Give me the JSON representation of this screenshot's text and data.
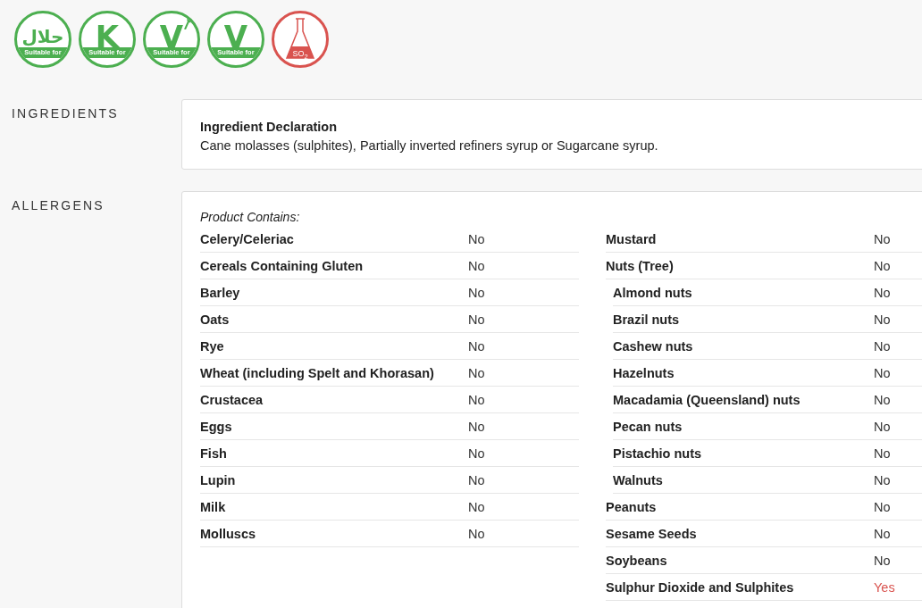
{
  "badges": [
    {
      "kind": "suitable",
      "symbol": "حلال",
      "caption": "Suitable for"
    },
    {
      "kind": "suitable",
      "symbol": "K",
      "caption": "Suitable for"
    },
    {
      "kind": "suitable_leaf",
      "symbol": "V",
      "caption": "Suitable for"
    },
    {
      "kind": "suitable",
      "symbol": "V",
      "caption": "Suitable for"
    },
    {
      "kind": "contains",
      "symbol": "SO$_{2}$"
    }
  ],
  "ingredients": {
    "heading": "INGREDIENTS",
    "title": "Ingredient Declaration",
    "text": "Cane molasses (sulphites), Partially inverted refiners syrup or Sugarcane syrup."
  },
  "allergens": {
    "heading": "ALLERGENS",
    "subtitle": "Product Contains:",
    "columns": [
      [
        {
          "name": "Celery/Celeriac",
          "value": "No",
          "contains": false
        },
        {
          "name": "Cereals Containing Gluten",
          "value": "No",
          "contains": false
        },
        {
          "name": "Barley",
          "value": "No",
          "contains": false
        },
        {
          "name": "Oats",
          "value": "No",
          "contains": false
        },
        {
          "name": "Rye",
          "value": "No",
          "contains": false
        },
        {
          "name": "Wheat (including Spelt and Khorasan)",
          "value": "No",
          "contains": false
        },
        {
          "name": "Crustacea",
          "value": "No",
          "contains": false
        },
        {
          "name": "Eggs",
          "value": "No",
          "contains": false
        },
        {
          "name": "Fish",
          "value": "No",
          "contains": false
        },
        {
          "name": "Lupin",
          "value": "No",
          "contains": false
        },
        {
          "name": "Milk",
          "value": "No",
          "contains": false
        },
        {
          "name": "Molluscs",
          "value": "No",
          "contains": false
        }
      ],
      [
        {
          "name": "Mustard",
          "value": "No",
          "contains": false
        },
        {
          "name": "Nuts (Tree)",
          "value": "No",
          "contains": false,
          "children": [
            {
              "name": "Almond nuts",
              "value": "No",
              "contains": false
            },
            {
              "name": "Brazil nuts",
              "value": "No",
              "contains": false
            },
            {
              "name": "Cashew nuts",
              "value": "No",
              "contains": false
            },
            {
              "name": "Hazelnuts",
              "value": "No",
              "contains": false
            },
            {
              "name": "Macadamia (Queensland) nuts",
              "value": "No",
              "contains": false
            },
            {
              "name": "Pecan nuts",
              "value": "No",
              "contains": false
            },
            {
              "name": "Pistachio nuts",
              "value": "No",
              "contains": false
            },
            {
              "name": "Walnuts",
              "value": "No",
              "contains": false
            }
          ]
        },
        {
          "name": "Peanuts",
          "value": "No",
          "contains": false
        },
        {
          "name": "Sesame Seeds",
          "value": "No",
          "contains": false
        },
        {
          "name": "Soybeans",
          "value": "No",
          "contains": false
        },
        {
          "name": "Sulphur Dioxide and Sulphites",
          "value": "Yes",
          "contains": true
        }
      ]
    ]
  }
}
